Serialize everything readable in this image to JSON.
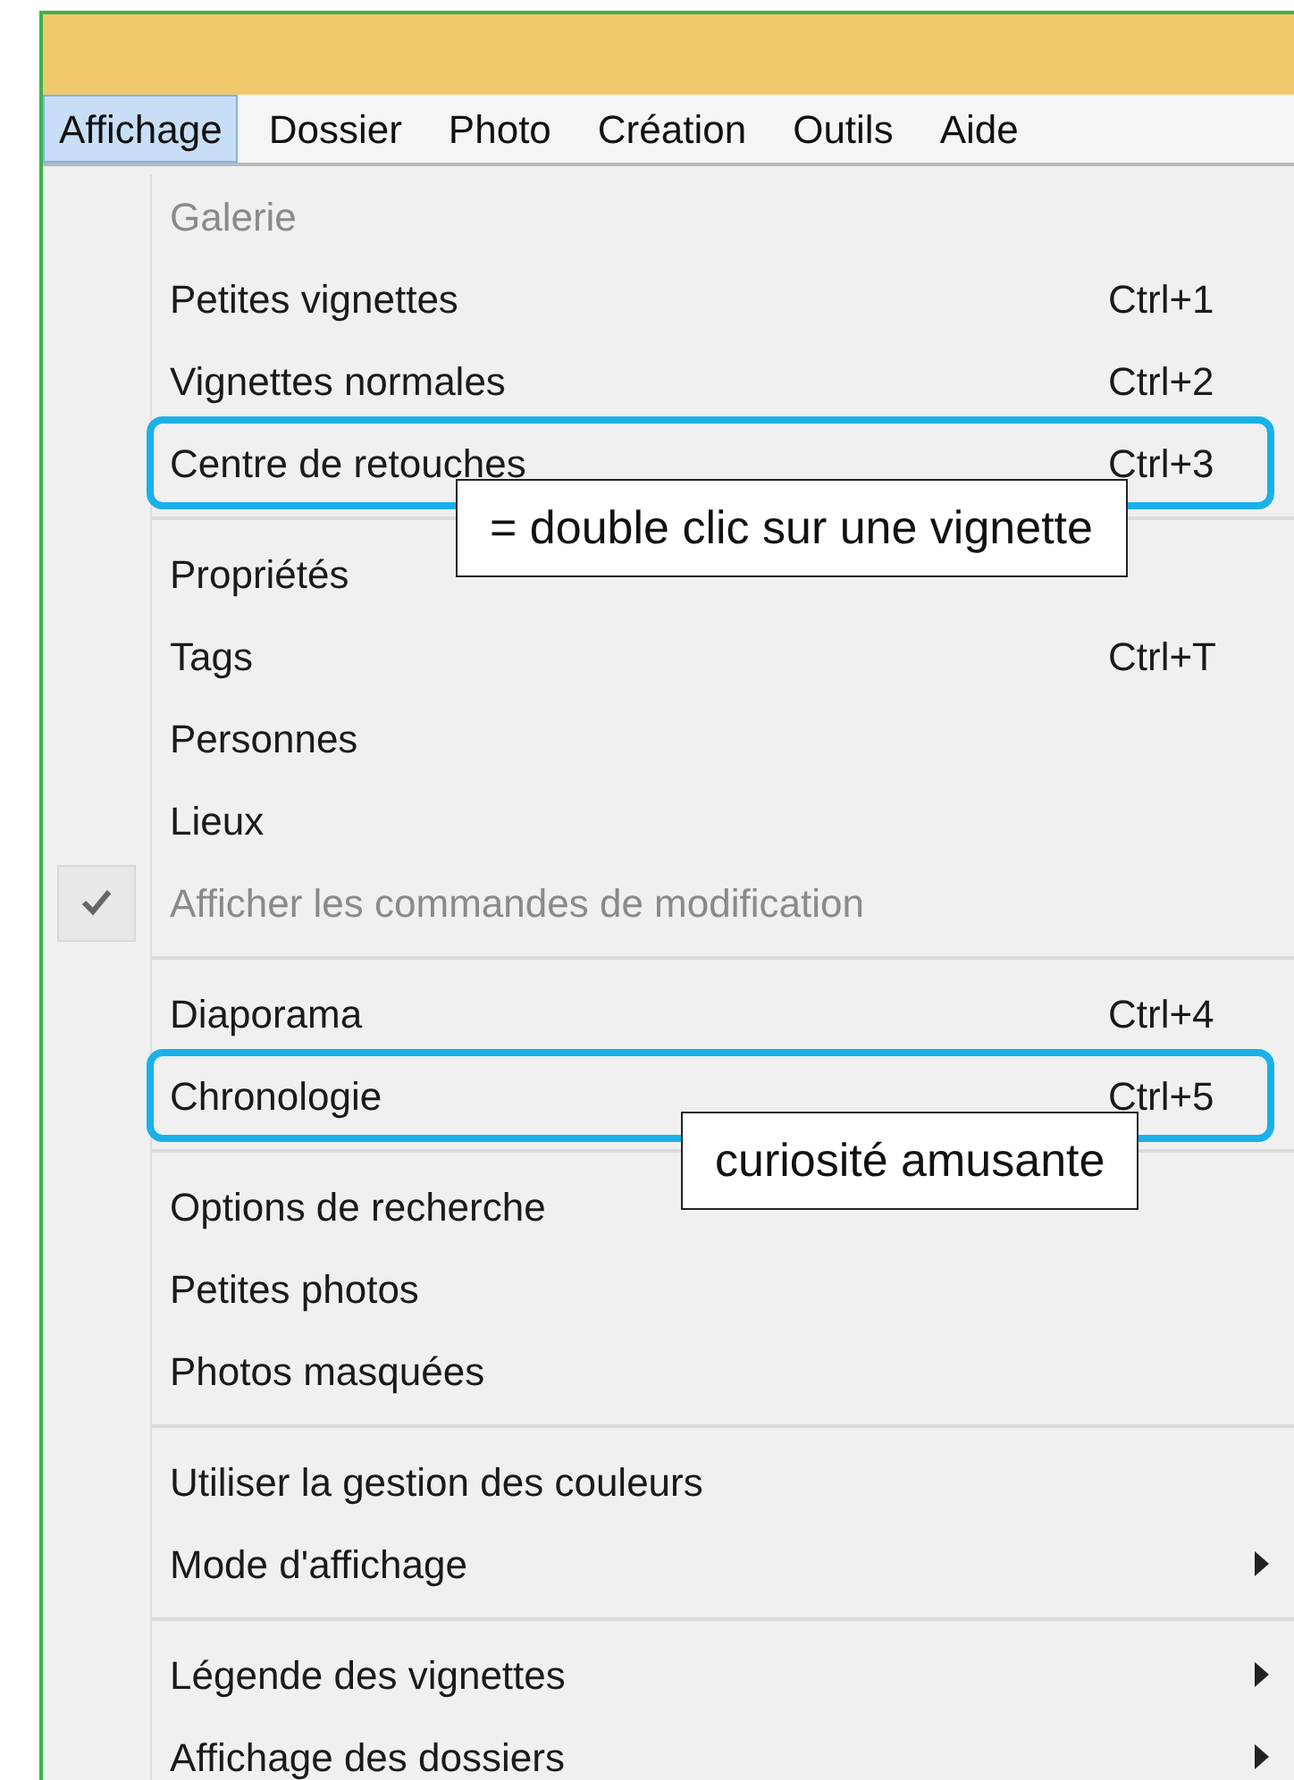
{
  "menu_bar": [
    {
      "label": "Affichage",
      "selected": true
    },
    {
      "label": "Dossier",
      "selected": false
    },
    {
      "label": "Photo",
      "selected": false
    },
    {
      "label": "Création",
      "selected": false
    },
    {
      "label": "Outils",
      "selected": false
    },
    {
      "label": "Aide",
      "selected": false
    }
  ],
  "menu": {
    "sections": [
      {
        "items": [
          {
            "label": "Galerie",
            "disabled": true
          },
          {
            "label": "Petites vignettes",
            "shortcut": "Ctrl+1",
            "disabled": false
          },
          {
            "label": "Vignettes normales",
            "shortcut": "Ctrl+2",
            "disabled": false
          },
          {
            "label": "Centre de retouches",
            "shortcut": "Ctrl+3",
            "disabled": false,
            "highlighted": true,
            "callout": "= double clic sur une vignette"
          }
        ]
      },
      {
        "items": [
          {
            "label": "Propriétés",
            "disabled": false
          },
          {
            "label": "Tags",
            "shortcut": "Ctrl+T",
            "disabled": false
          },
          {
            "label": "Personnes",
            "disabled": false
          },
          {
            "label": "Lieux",
            "disabled": false
          },
          {
            "label": "Afficher les commandes de modification",
            "disabled": true,
            "checked": true
          }
        ]
      },
      {
        "items": [
          {
            "label": "Diaporama",
            "shortcut": "Ctrl+4",
            "disabled": false
          },
          {
            "label": "Chronologie",
            "shortcut": "Ctrl+5",
            "disabled": false,
            "highlighted": true,
            "callout": "curiosité amusante"
          }
        ]
      },
      {
        "items": [
          {
            "label": "Options de recherche",
            "disabled": false
          },
          {
            "label": "Petites photos",
            "disabled": false
          },
          {
            "label": "Photos masquées",
            "disabled": false
          }
        ]
      },
      {
        "items": [
          {
            "label": "Utiliser la gestion des couleurs",
            "disabled": false
          },
          {
            "label": "Mode d'affichage",
            "disabled": false,
            "submenu": true
          }
        ]
      },
      {
        "items": [
          {
            "label": "Légende des vignettes",
            "disabled": false,
            "submenu": true
          },
          {
            "label": "Affichage des dossiers",
            "disabled": false,
            "submenu": true
          }
        ]
      }
    ]
  }
}
